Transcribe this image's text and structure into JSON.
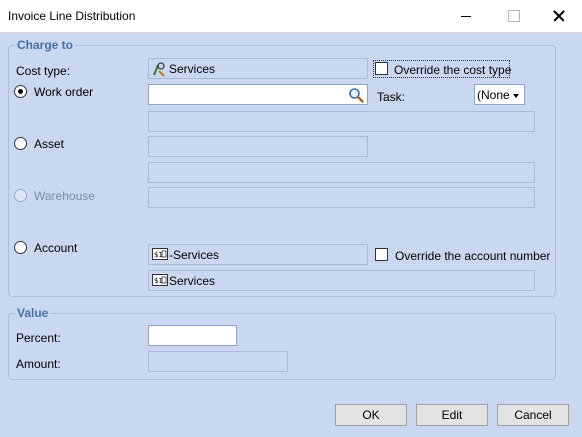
{
  "window": {
    "title": "Invoice Line Distribution"
  },
  "charge_to": {
    "legend": "Charge to",
    "cost_type_label": "Cost type:",
    "cost_type_value": "Services",
    "override_cost_type_label": "Override the cost type",
    "override_cost_type_checked": false,
    "work_order_label": "Work order",
    "work_order_value": "",
    "work_order_selected": true,
    "task_label": "Task:",
    "task_value": "(None",
    "asset_label": "Asset",
    "asset_selected": false,
    "warehouse_label": "Warehouse",
    "warehouse_enabled": false,
    "account_label": "Account",
    "account_selected": false,
    "account_value": "-Services",
    "account_description": "Services",
    "override_account_label": "Override the account number",
    "override_account_checked": false
  },
  "value": {
    "legend": "Value",
    "percent_label": "Percent:",
    "percent_value": "",
    "amount_label": "Amount:",
    "amount_value": ""
  },
  "buttons": {
    "ok": "OK",
    "edit": "Edit",
    "cancel": "Cancel"
  },
  "icons": {
    "cost_type": "services-cost-type-icon",
    "search": "search-icon",
    "account": "gl-account-icon"
  }
}
